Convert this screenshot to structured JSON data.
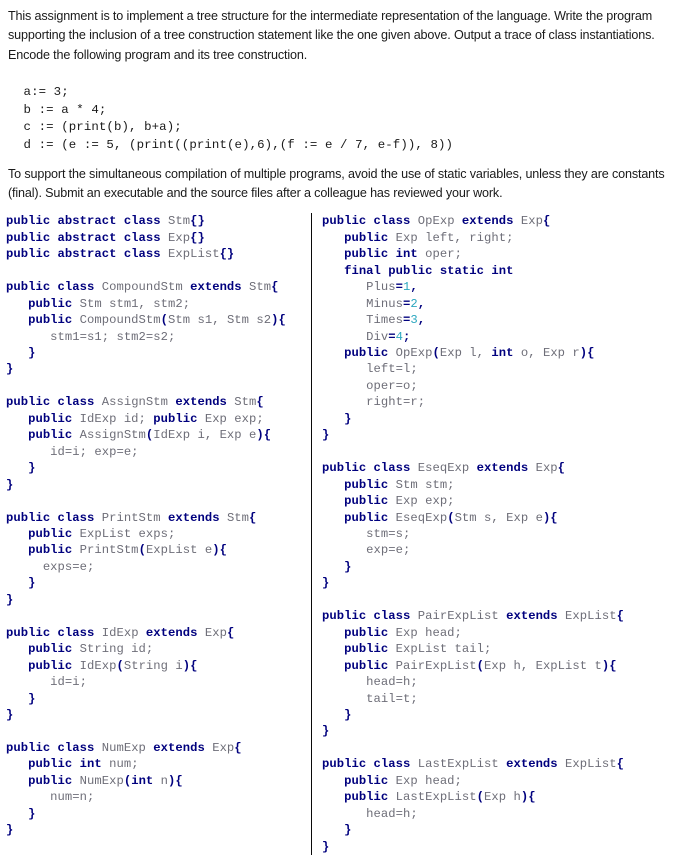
{
  "document": {
    "intro_paragraph": "This assignment is to implement a tree structure for the intermediate representation of the language.  Write the program supporting the inclusion of a tree construction statement like the one given above.  Output a trace of class instantiations.  Encode the following program and its tree construction.",
    "program_listing": " a:= 3;\n b := a * 4;\n c := (print(b), b+a);\n d := (e := 5, (print((print(e),6),(f := e / 7, e-f)), 8))",
    "closing_paragraph": "To support the simultaneous compilation of multiple programs, avoid the use of static variables, unless they are constants (final).  Submit an executable and the source files after a colleague has reviewed your work."
  },
  "colors": {
    "keyword": "#00007e",
    "identifier": "#6e6e78",
    "number": "#2ba7bf",
    "text": "#1a1a1a",
    "divider": "#0a0a0a"
  },
  "code": {
    "left_column": [
      [
        {
          "t": "public abstract class ",
          "c": "k"
        },
        {
          "t": "Stm",
          "c": "id"
        },
        {
          "t": "{}",
          "c": "k"
        }
      ],
      [
        {
          "t": "public abstract class ",
          "c": "k"
        },
        {
          "t": "Exp",
          "c": "id"
        },
        {
          "t": "{}",
          "c": "k"
        }
      ],
      [
        {
          "t": "public abstract class ",
          "c": "k"
        },
        {
          "t": "ExpList",
          "c": "id"
        },
        {
          "t": "{}",
          "c": "k"
        }
      ],
      [],
      [
        {
          "t": "public class ",
          "c": "k"
        },
        {
          "t": "CompoundStm ",
          "c": "id"
        },
        {
          "t": "extends ",
          "c": "k"
        },
        {
          "t": "Stm",
          "c": "id"
        },
        {
          "t": "{",
          "c": "k"
        }
      ],
      [
        {
          "t": "   ",
          "c": "id"
        },
        {
          "t": "public ",
          "c": "k"
        },
        {
          "t": "Stm stm1, stm2;",
          "c": "id"
        }
      ],
      [
        {
          "t": "   ",
          "c": "id"
        },
        {
          "t": "public ",
          "c": "k"
        },
        {
          "t": "CompoundStm",
          "c": "id"
        },
        {
          "t": "(",
          "c": "k"
        },
        {
          "t": "Stm s1, Stm s2",
          "c": "id"
        },
        {
          "t": "){",
          "c": "k"
        }
      ],
      [
        {
          "t": "      stm1=s1; stm2=s2;",
          "c": "id"
        }
      ],
      [
        {
          "t": "   ",
          "c": "id"
        },
        {
          "t": "}",
          "c": "k"
        }
      ],
      [
        {
          "t": "}",
          "c": "k"
        }
      ],
      [],
      [
        {
          "t": "public class ",
          "c": "k"
        },
        {
          "t": "AssignStm ",
          "c": "id"
        },
        {
          "t": "extends ",
          "c": "k"
        },
        {
          "t": "Stm",
          "c": "id"
        },
        {
          "t": "{",
          "c": "k"
        }
      ],
      [
        {
          "t": "   ",
          "c": "id"
        },
        {
          "t": "public ",
          "c": "k"
        },
        {
          "t": "IdExp id; ",
          "c": "id"
        },
        {
          "t": "public ",
          "c": "k"
        },
        {
          "t": "Exp exp;",
          "c": "id"
        }
      ],
      [
        {
          "t": "   ",
          "c": "id"
        },
        {
          "t": "public ",
          "c": "k"
        },
        {
          "t": "AssignStm",
          "c": "id"
        },
        {
          "t": "(",
          "c": "k"
        },
        {
          "t": "IdExp i, Exp e",
          "c": "id"
        },
        {
          "t": "){",
          "c": "k"
        }
      ],
      [
        {
          "t": "      id=i; exp=e;",
          "c": "id"
        }
      ],
      [
        {
          "t": "   ",
          "c": "id"
        },
        {
          "t": "}",
          "c": "k"
        }
      ],
      [
        {
          "t": "}",
          "c": "k"
        }
      ],
      [],
      [
        {
          "t": "public class ",
          "c": "k"
        },
        {
          "t": "PrintStm ",
          "c": "id"
        },
        {
          "t": "extends ",
          "c": "k"
        },
        {
          "t": "Stm",
          "c": "id"
        },
        {
          "t": "{",
          "c": "k"
        }
      ],
      [
        {
          "t": "   ",
          "c": "id"
        },
        {
          "t": "public ",
          "c": "k"
        },
        {
          "t": "ExpList exps;",
          "c": "id"
        }
      ],
      [
        {
          "t": "   ",
          "c": "id"
        },
        {
          "t": "public ",
          "c": "k"
        },
        {
          "t": "PrintStm",
          "c": "id"
        },
        {
          "t": "(",
          "c": "k"
        },
        {
          "t": "ExpList e",
          "c": "id"
        },
        {
          "t": "){",
          "c": "k"
        }
      ],
      [
        {
          "t": "     exps=e;",
          "c": "id"
        }
      ],
      [
        {
          "t": "   ",
          "c": "id"
        },
        {
          "t": "}",
          "c": "k"
        }
      ],
      [
        {
          "t": "}",
          "c": "k"
        }
      ],
      [],
      [
        {
          "t": "public class ",
          "c": "k"
        },
        {
          "t": "IdExp ",
          "c": "id"
        },
        {
          "t": "extends ",
          "c": "k"
        },
        {
          "t": "Exp",
          "c": "id"
        },
        {
          "t": "{",
          "c": "k"
        }
      ],
      [
        {
          "t": "   ",
          "c": "id"
        },
        {
          "t": "public ",
          "c": "k"
        },
        {
          "t": "String id;",
          "c": "id"
        }
      ],
      [
        {
          "t": "   ",
          "c": "id"
        },
        {
          "t": "public ",
          "c": "k"
        },
        {
          "t": "IdExp",
          "c": "id"
        },
        {
          "t": "(",
          "c": "k"
        },
        {
          "t": "String i",
          "c": "id"
        },
        {
          "t": "){",
          "c": "k"
        }
      ],
      [
        {
          "t": "      id=i;",
          "c": "id"
        }
      ],
      [
        {
          "t": "   ",
          "c": "id"
        },
        {
          "t": "}",
          "c": "k"
        }
      ],
      [
        {
          "t": "}",
          "c": "k"
        }
      ],
      [],
      [
        {
          "t": "public class ",
          "c": "k"
        },
        {
          "t": "NumExp ",
          "c": "id"
        },
        {
          "t": "extends ",
          "c": "k"
        },
        {
          "t": "Exp",
          "c": "id"
        },
        {
          "t": "{",
          "c": "k"
        }
      ],
      [
        {
          "t": "   ",
          "c": "id"
        },
        {
          "t": "public int ",
          "c": "k"
        },
        {
          "t": "num;",
          "c": "id"
        }
      ],
      [
        {
          "t": "   ",
          "c": "id"
        },
        {
          "t": "public ",
          "c": "k"
        },
        {
          "t": "NumExp",
          "c": "id"
        },
        {
          "t": "(",
          "c": "k"
        },
        {
          "t": "int ",
          "c": "k"
        },
        {
          "t": "n",
          "c": "id"
        },
        {
          "t": "){",
          "c": "k"
        }
      ],
      [
        {
          "t": "      num=n;",
          "c": "id"
        }
      ],
      [
        {
          "t": "   ",
          "c": "id"
        },
        {
          "t": "}",
          "c": "k"
        }
      ],
      [
        {
          "t": "}",
          "c": "k"
        }
      ]
    ],
    "right_column": [
      [
        {
          "t": "public class ",
          "c": "k"
        },
        {
          "t": "OpExp ",
          "c": "id"
        },
        {
          "t": "extends ",
          "c": "k"
        },
        {
          "t": "Exp",
          "c": "id"
        },
        {
          "t": "{",
          "c": "k"
        }
      ],
      [
        {
          "t": "   ",
          "c": "id"
        },
        {
          "t": "public ",
          "c": "k"
        },
        {
          "t": "Exp left, right;",
          "c": "id"
        }
      ],
      [
        {
          "t": "   ",
          "c": "id"
        },
        {
          "t": "public int ",
          "c": "k"
        },
        {
          "t": "oper;",
          "c": "id"
        }
      ],
      [
        {
          "t": "   ",
          "c": "id"
        },
        {
          "t": "final public static int",
          "c": "k"
        }
      ],
      [
        {
          "t": "      Plus",
          "c": "id"
        },
        {
          "t": "=",
          "c": "k"
        },
        {
          "t": "1",
          "c": "n"
        },
        {
          "t": ",",
          "c": "k"
        }
      ],
      [
        {
          "t": "      Minus",
          "c": "id"
        },
        {
          "t": "=",
          "c": "k"
        },
        {
          "t": "2",
          "c": "n"
        },
        {
          "t": ",",
          "c": "k"
        }
      ],
      [
        {
          "t": "      Times",
          "c": "id"
        },
        {
          "t": "=",
          "c": "k"
        },
        {
          "t": "3",
          "c": "n"
        },
        {
          "t": ",",
          "c": "k"
        }
      ],
      [
        {
          "t": "      Div",
          "c": "id"
        },
        {
          "t": "=",
          "c": "k"
        },
        {
          "t": "4",
          "c": "n"
        },
        {
          "t": ";",
          "c": "k"
        }
      ],
      [
        {
          "t": "   ",
          "c": "id"
        },
        {
          "t": "public ",
          "c": "k"
        },
        {
          "t": "OpExp",
          "c": "id"
        },
        {
          "t": "(",
          "c": "k"
        },
        {
          "t": "Exp l, ",
          "c": "id"
        },
        {
          "t": "int ",
          "c": "k"
        },
        {
          "t": "o, Exp r",
          "c": "id"
        },
        {
          "t": "){",
          "c": "k"
        }
      ],
      [
        {
          "t": "      left=l;",
          "c": "id"
        }
      ],
      [
        {
          "t": "      oper=o;",
          "c": "id"
        }
      ],
      [
        {
          "t": "      right=r;",
          "c": "id"
        }
      ],
      [
        {
          "t": "   ",
          "c": "id"
        },
        {
          "t": "}",
          "c": "k"
        }
      ],
      [
        {
          "t": "}",
          "c": "k"
        }
      ],
      [],
      [
        {
          "t": "public class ",
          "c": "k"
        },
        {
          "t": "EseqExp ",
          "c": "id"
        },
        {
          "t": "extends ",
          "c": "k"
        },
        {
          "t": "Exp",
          "c": "id"
        },
        {
          "t": "{",
          "c": "k"
        }
      ],
      [
        {
          "t": "   ",
          "c": "id"
        },
        {
          "t": "public ",
          "c": "k"
        },
        {
          "t": "Stm stm;",
          "c": "id"
        }
      ],
      [
        {
          "t": "   ",
          "c": "id"
        },
        {
          "t": "public ",
          "c": "k"
        },
        {
          "t": "Exp exp;",
          "c": "id"
        }
      ],
      [
        {
          "t": "   ",
          "c": "id"
        },
        {
          "t": "public ",
          "c": "k"
        },
        {
          "t": "EseqExp",
          "c": "id"
        },
        {
          "t": "(",
          "c": "k"
        },
        {
          "t": "Stm s, Exp e",
          "c": "id"
        },
        {
          "t": "){",
          "c": "k"
        }
      ],
      [
        {
          "t": "      stm=s;",
          "c": "id"
        }
      ],
      [
        {
          "t": "      exp=e;",
          "c": "id"
        }
      ],
      [
        {
          "t": "   ",
          "c": "id"
        },
        {
          "t": "}",
          "c": "k"
        }
      ],
      [
        {
          "t": "}",
          "c": "k"
        }
      ],
      [],
      [
        {
          "t": "public class ",
          "c": "k"
        },
        {
          "t": "PairExpList ",
          "c": "id"
        },
        {
          "t": "extends ",
          "c": "k"
        },
        {
          "t": "ExpList",
          "c": "id"
        },
        {
          "t": "{",
          "c": "k"
        }
      ],
      [
        {
          "t": "   ",
          "c": "id"
        },
        {
          "t": "public ",
          "c": "k"
        },
        {
          "t": "Exp head;",
          "c": "id"
        }
      ],
      [
        {
          "t": "   ",
          "c": "id"
        },
        {
          "t": "public ",
          "c": "k"
        },
        {
          "t": "ExpList tail;",
          "c": "id"
        }
      ],
      [
        {
          "t": "   ",
          "c": "id"
        },
        {
          "t": "public ",
          "c": "k"
        },
        {
          "t": "PairExpList",
          "c": "id"
        },
        {
          "t": "(",
          "c": "k"
        },
        {
          "t": "Exp h, ExpList t",
          "c": "id"
        },
        {
          "t": "){",
          "c": "k"
        }
      ],
      [
        {
          "t": "      head=h;",
          "c": "id"
        }
      ],
      [
        {
          "t": "      tail=t;",
          "c": "id"
        }
      ],
      [
        {
          "t": "   ",
          "c": "id"
        },
        {
          "t": "}",
          "c": "k"
        }
      ],
      [
        {
          "t": "}",
          "c": "k"
        }
      ],
      [],
      [
        {
          "t": "public class ",
          "c": "k"
        },
        {
          "t": "LastExpList ",
          "c": "id"
        },
        {
          "t": "extends ",
          "c": "k"
        },
        {
          "t": "ExpList",
          "c": "id"
        },
        {
          "t": "{",
          "c": "k"
        }
      ],
      [
        {
          "t": "   ",
          "c": "id"
        },
        {
          "t": "public ",
          "c": "k"
        },
        {
          "t": "Exp head;",
          "c": "id"
        }
      ],
      [
        {
          "t": "   ",
          "c": "id"
        },
        {
          "t": "public ",
          "c": "k"
        },
        {
          "t": "LastExpList",
          "c": "id"
        },
        {
          "t": "(",
          "c": "k"
        },
        {
          "t": "Exp h",
          "c": "id"
        },
        {
          "t": "){",
          "c": "k"
        }
      ],
      [
        {
          "t": "      head=h;",
          "c": "id"
        }
      ],
      [
        {
          "t": "   ",
          "c": "id"
        },
        {
          "t": "}",
          "c": "k"
        }
      ],
      [
        {
          "t": "}",
          "c": "k"
        }
      ]
    ]
  }
}
